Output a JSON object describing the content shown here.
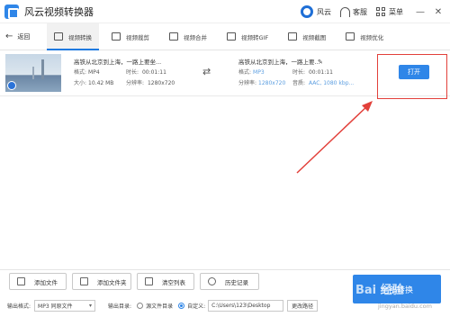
{
  "app": {
    "title": "风云视频转换器"
  },
  "titlebar": {
    "brand": "风云",
    "service": "客服",
    "menu": "菜单",
    "min": "—",
    "close": "✕"
  },
  "nav": {
    "back": "返回",
    "tabs": [
      "视频转换",
      "视频裁剪",
      "视频合并",
      "视频转GIF",
      "视频截图",
      "视频优化"
    ]
  },
  "file": {
    "source": {
      "name": "高铁从北京到上海，一路上要坐...",
      "format_key": "格式:",
      "format": "MP4",
      "duration_key": "时长:",
      "duration": "00:01:11",
      "size_key": "大小:",
      "size": "10.42 MB",
      "resolution_key": "分辨率:",
      "resolution": "1280x720"
    },
    "output": {
      "name": "高铁从北京到上海，一路上要...",
      "format_key": "格式:",
      "format": "MP3",
      "duration_key": "时长:",
      "duration": "00:01:11",
      "resolution_key": "分辨率:",
      "resolution": "1280x720",
      "audio_key": "音质:",
      "audio": "AAC, 1080 kbp..."
    },
    "open_button": "打开"
  },
  "bottom": {
    "add_file": "添加文件",
    "add_folder": "添加文件夹",
    "clear_list": "清空列表",
    "history": "历史记录",
    "convert_all": "全部转换",
    "format_label": "输出格式:",
    "format_value": "MP3 同原文件",
    "dir_label": "输出目录:",
    "opt_source": "源文件目录",
    "opt_custom": "自定义:",
    "path": "C:\\Users\\123\\Desktop",
    "change_path": "更改路径"
  },
  "watermark": {
    "main": "Bai 经验",
    "sub": "jingyan.baidu.com"
  },
  "colors": {
    "accent": "#2f86e8",
    "annotation": "#e2403a"
  }
}
